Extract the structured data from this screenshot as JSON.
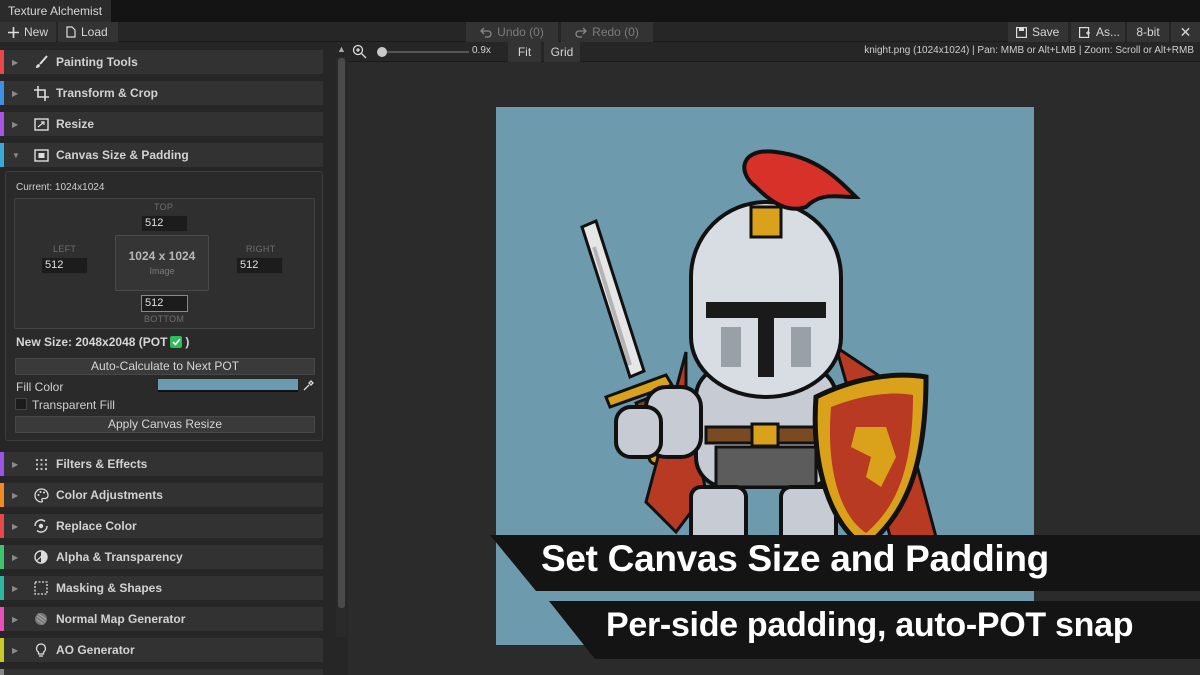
{
  "app": {
    "title": "Texture Alchemist"
  },
  "toolbar": {
    "new_label": "New",
    "load_label": "Load",
    "undo_label": "Undo (0)",
    "redo_label": "Redo (0)",
    "save_label": "Save",
    "save_as_label": "As...",
    "bit_depth_label": "8-bit",
    "close_label": "✕"
  },
  "sidebar": {
    "sections": [
      {
        "label": "Painting Tools",
        "color": "#e8474c",
        "icon": "brush-icon",
        "expanded": false
      },
      {
        "label": "Transform & Crop",
        "color": "#3f8fe6",
        "icon": "crop-icon",
        "expanded": false
      },
      {
        "label": "Resize",
        "color": "#a855e6",
        "icon": "resize-icon",
        "expanded": false
      },
      {
        "label": "Canvas Size & Padding",
        "color": "#3aa8d8",
        "icon": "canvas-icon",
        "expanded": true
      },
      {
        "label": "Filters & Effects",
        "color": "#9a56e0",
        "icon": "grid-icon",
        "expanded": false
      },
      {
        "label": "Color Adjustments",
        "color": "#f08a24",
        "icon": "palette-icon",
        "expanded": false
      },
      {
        "label": "Replace Color",
        "color": "#e8474c",
        "icon": "replace-color-icon",
        "expanded": false
      },
      {
        "label": "Alpha & Transparency",
        "color": "#3ec46d",
        "icon": "alpha-icon",
        "expanded": false
      },
      {
        "label": "Masking & Shapes",
        "color": "#2fb8a0",
        "icon": "mask-icon",
        "expanded": false
      },
      {
        "label": "Normal Map Generator",
        "color": "#e84fb8",
        "icon": "sphere-icon",
        "expanded": false
      },
      {
        "label": "AO Generator",
        "color": "#c9c92a",
        "icon": "bulb-icon",
        "expanded": false
      }
    ]
  },
  "canvas_panel": {
    "current": "Current: 1024x1024",
    "top_label": "TOP",
    "left_label": "LEFT",
    "right_label": "RIGHT",
    "bottom_label": "BOTTOM",
    "top_value": "512",
    "left_value": "512",
    "right_value": "512",
    "bottom_value": "512",
    "image_dims": "1024 x 1024",
    "image_label": "Image",
    "new_size_prefix": "New Size: 2048x2048 (POT",
    "new_size_suffix": ")",
    "auto_calc_label": "Auto-Calculate to Next POT",
    "fill_color_label": "Fill Color",
    "fill_color": "#6a9bb0",
    "transparent_fill_label": "Transparent Fill",
    "apply_label": "Apply Canvas Resize"
  },
  "view_toolbar": {
    "zoom_value": "0.9x",
    "zoom_level": 0.9,
    "fit_label": "Fit",
    "grid_label": "Grid",
    "info": "knight.png (1024x1024) |   Pan: MMB or Alt+LMB | Zoom: Scroll or Alt+RMB"
  },
  "canvas": {
    "background": "#6e9aae"
  },
  "banner": {
    "headline": "Set Canvas Size and Padding",
    "subline": "Per-side padding, auto-POT snap"
  }
}
